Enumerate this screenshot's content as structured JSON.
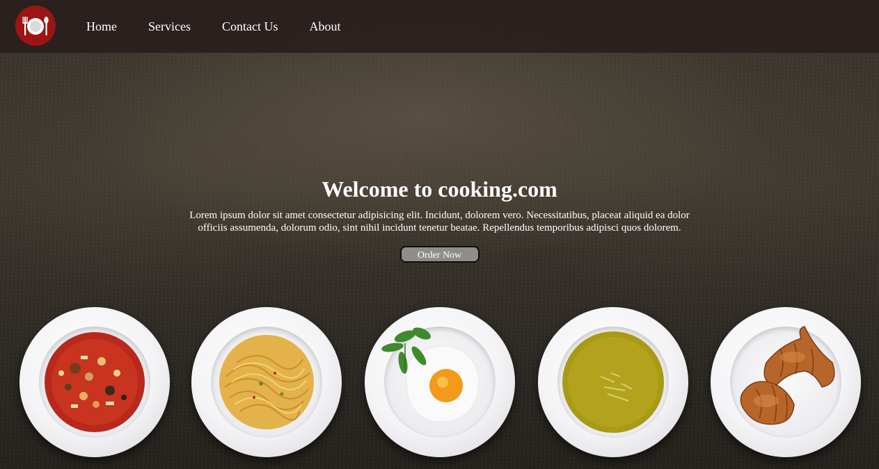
{
  "nav": {
    "logo_icon": "plate-fork-spoon-icon",
    "items": [
      {
        "label": "Home"
      },
      {
        "label": "Services"
      },
      {
        "label": "Contact Us"
      },
      {
        "label": "About"
      }
    ]
  },
  "hero": {
    "title": "Welcome to cooking.com",
    "text": "Lorem ipsum dolor sit amet consectetur adipisicing elit. Incidunt, dolorem vero. Necessitatibus, placeat aliquid ea dolor officiis assumenda, dolorum odio, sint nihil incidunt tenetur beatae. Repellendus temporibus adipisci quos dolorem.",
    "button_label": "Order Now"
  },
  "dishes": [
    {
      "name": "soup-plate-image"
    },
    {
      "name": "spaghetti-plate-image"
    },
    {
      "name": "fried-egg-plate-image"
    },
    {
      "name": "pea-soup-plate-image"
    },
    {
      "name": "croissant-plate-image"
    }
  ],
  "colors": {
    "logo_bg": "#9c1414",
    "navbar_bg": "#281e1c",
    "button_bg": "#8f8c89"
  }
}
